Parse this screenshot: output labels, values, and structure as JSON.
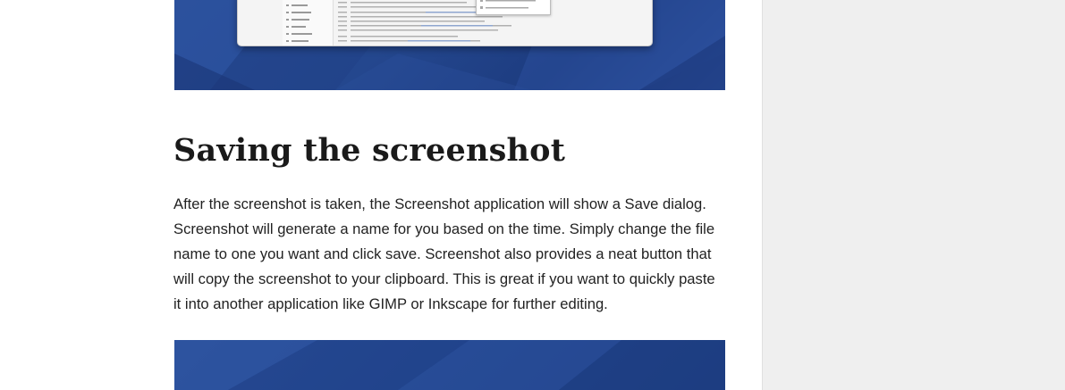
{
  "article": {
    "section_title": "Saving the screenshot",
    "paragraph": "After the screenshot is taken, the Screenshot application will show a Save dialog. Screenshot will generate a name for you based on the time. Simply change the file name to one you want and click save. Screenshot also provides a neat button that will copy the screenshot to your clipboard. This is great if you want to quickly paste it into another application like GIMP or Inkscape for further editing."
  },
  "images": {
    "top": "screenshot-illustration",
    "bottom": "screenshot-illustration"
  },
  "colors": {
    "banner_blue": "#24478e",
    "sidebar_bg": "#efefef",
    "heading_text": "#1a1a1a",
    "body_text": "#222222"
  }
}
